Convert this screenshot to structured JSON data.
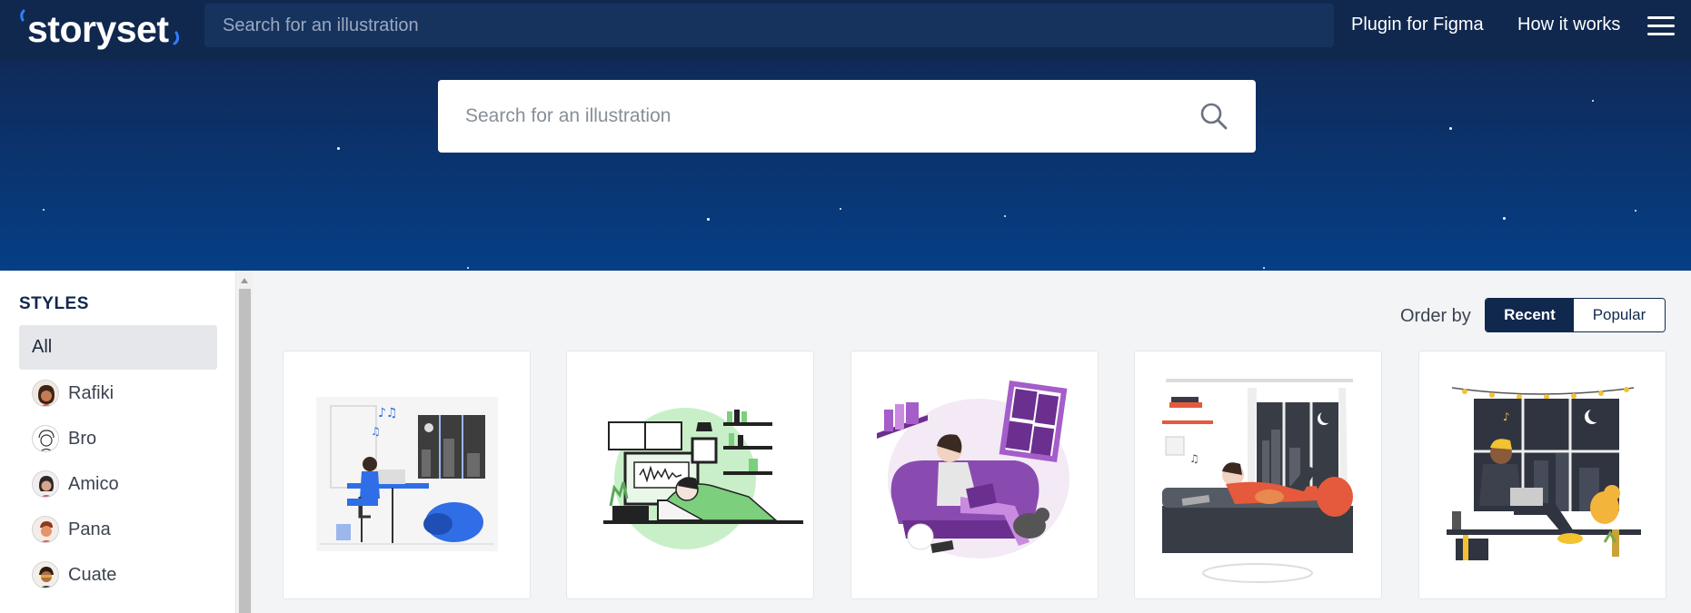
{
  "nav": {
    "logo_text": "storyset",
    "search_placeholder": "Search for an illustration",
    "plugin_link": "Plugin for Figma",
    "how_link": "How it works"
  },
  "hero": {
    "search_placeholder": "Search for an illustration"
  },
  "sidebar": {
    "title": "STYLES",
    "all_label": "All",
    "styles": [
      {
        "label": "Rafiki"
      },
      {
        "label": "Bro"
      },
      {
        "label": "Amico"
      },
      {
        "label": "Pana"
      },
      {
        "label": "Cuate"
      }
    ]
  },
  "toolbar": {
    "order_label": "Order by",
    "recent_label": "Recent",
    "popular_label": "Popular"
  },
  "colors": {
    "nav_bg": "#10284e",
    "hero_top": "#0f2a59",
    "hero_bottom": "#053f86",
    "accent_blue": "#2f6ee6"
  },
  "cards": [
    {
      "illustration": "person-at-desk-night-music"
    },
    {
      "illustration": "person-asleep-on-desk-with-monitor"
    },
    {
      "illustration": "person-reading-on-purple-couch"
    },
    {
      "illustration": "person-lying-on-bed-with-cat-night-window"
    },
    {
      "illustration": "person-with-laptop-by-window-with-lights"
    }
  ]
}
